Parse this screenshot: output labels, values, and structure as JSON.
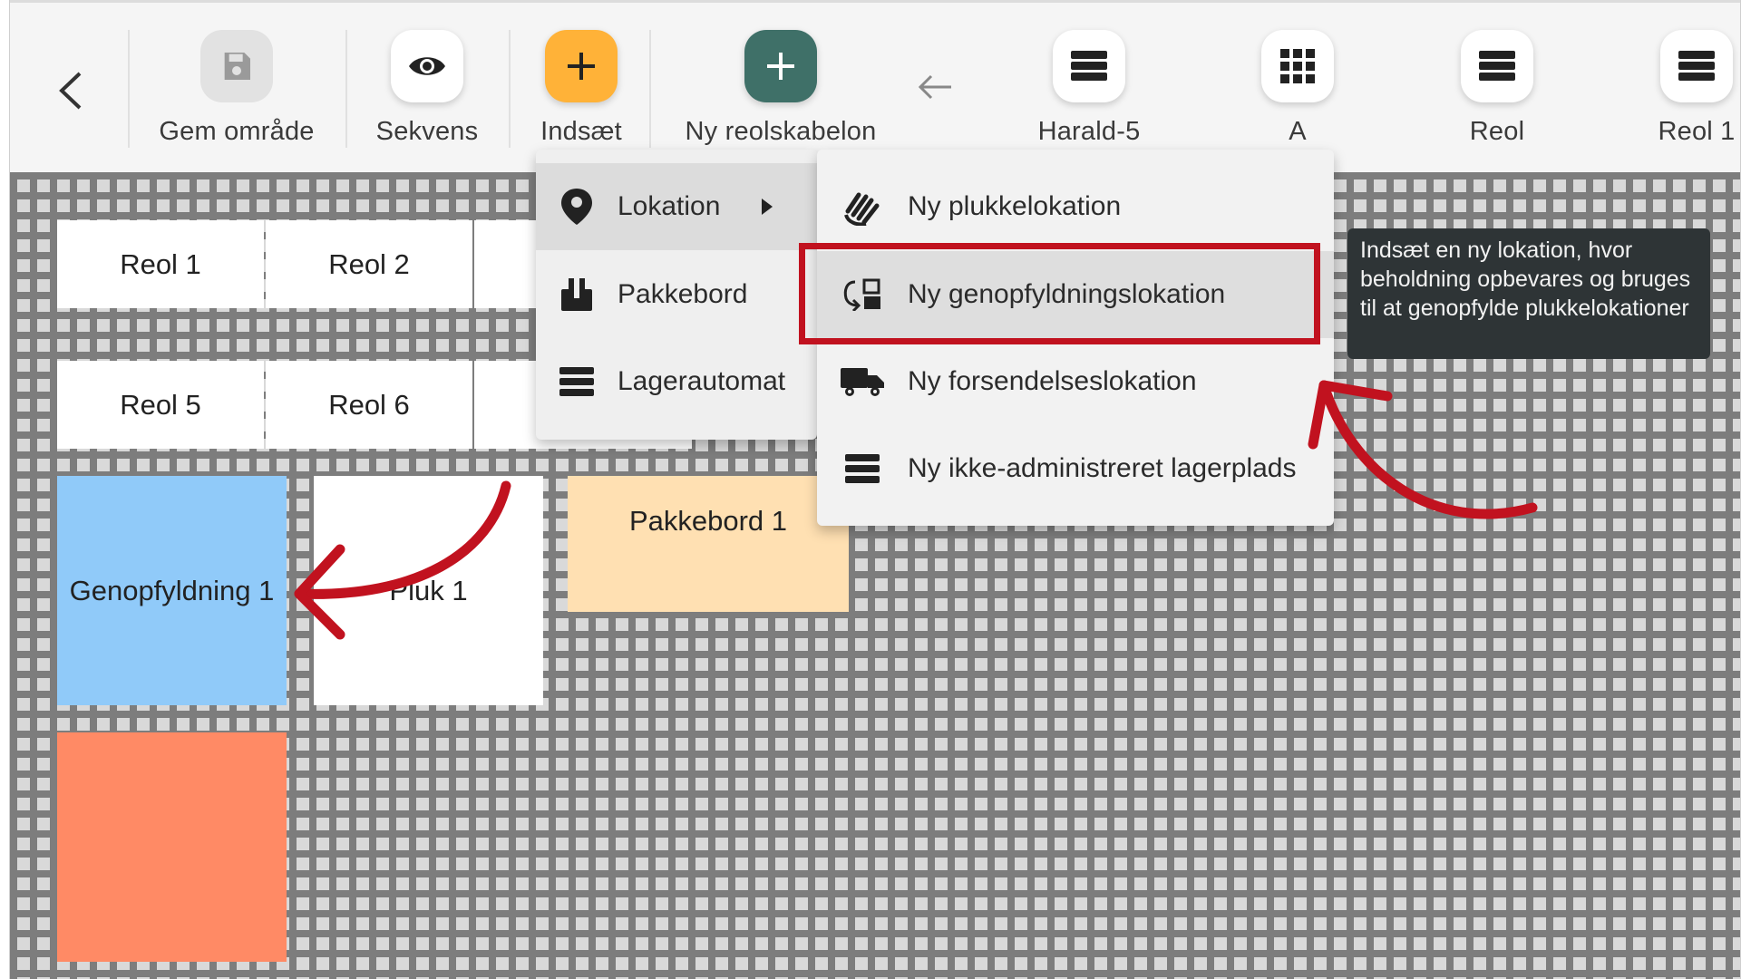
{
  "toolbar": {
    "save_label": "Gem område",
    "sequence_label": "Sekvens",
    "insert_label": "Indsæt",
    "new_template_label": "Ny reolskabelon",
    "items": [
      {
        "label": "Harald-5",
        "icon": "list-icon"
      },
      {
        "label": "A",
        "icon": "grid-icon"
      },
      {
        "label": "Reol",
        "icon": "list-icon"
      },
      {
        "label": "Reol 1",
        "icon": "list-icon"
      }
    ]
  },
  "canvas": {
    "boxes": [
      "Reol 1",
      "Reol 2",
      "Reol 5",
      "Reol 6",
      "Genopfyldning 1",
      "Pluk 1",
      "Pakkebord 1"
    ]
  },
  "insert_menu": {
    "items": [
      {
        "label": "Lokation",
        "icon": "location-pin-icon"
      },
      {
        "label": "Pakkebord",
        "icon": "package-table-icon"
      },
      {
        "label": "Lagerautomat",
        "icon": "list-icon"
      }
    ]
  },
  "location_submenu": {
    "items": [
      {
        "label": "Ny plukkelokation",
        "icon": "hand-pick-icon"
      },
      {
        "label": "Ny genopfyldningslokation",
        "icon": "replenish-icon"
      },
      {
        "label": "Ny forsendelseslokation",
        "icon": "truck-icon"
      },
      {
        "label": "Ny ikke-administreret lagerplads",
        "icon": "list-icon"
      }
    ]
  },
  "tooltip": {
    "text": "Indsæt en ny lokation, hvor beholdning opbevares og bruges til at genopfylde plukkelokationer"
  },
  "colors": {
    "insert_button": "#ffb238",
    "new_template_button": "#3f7068",
    "replenish_box": "#90caf9",
    "pack_table_box": "#ffe0b2",
    "orange_box": "#ff8a65",
    "annotation": "#c1121f"
  }
}
